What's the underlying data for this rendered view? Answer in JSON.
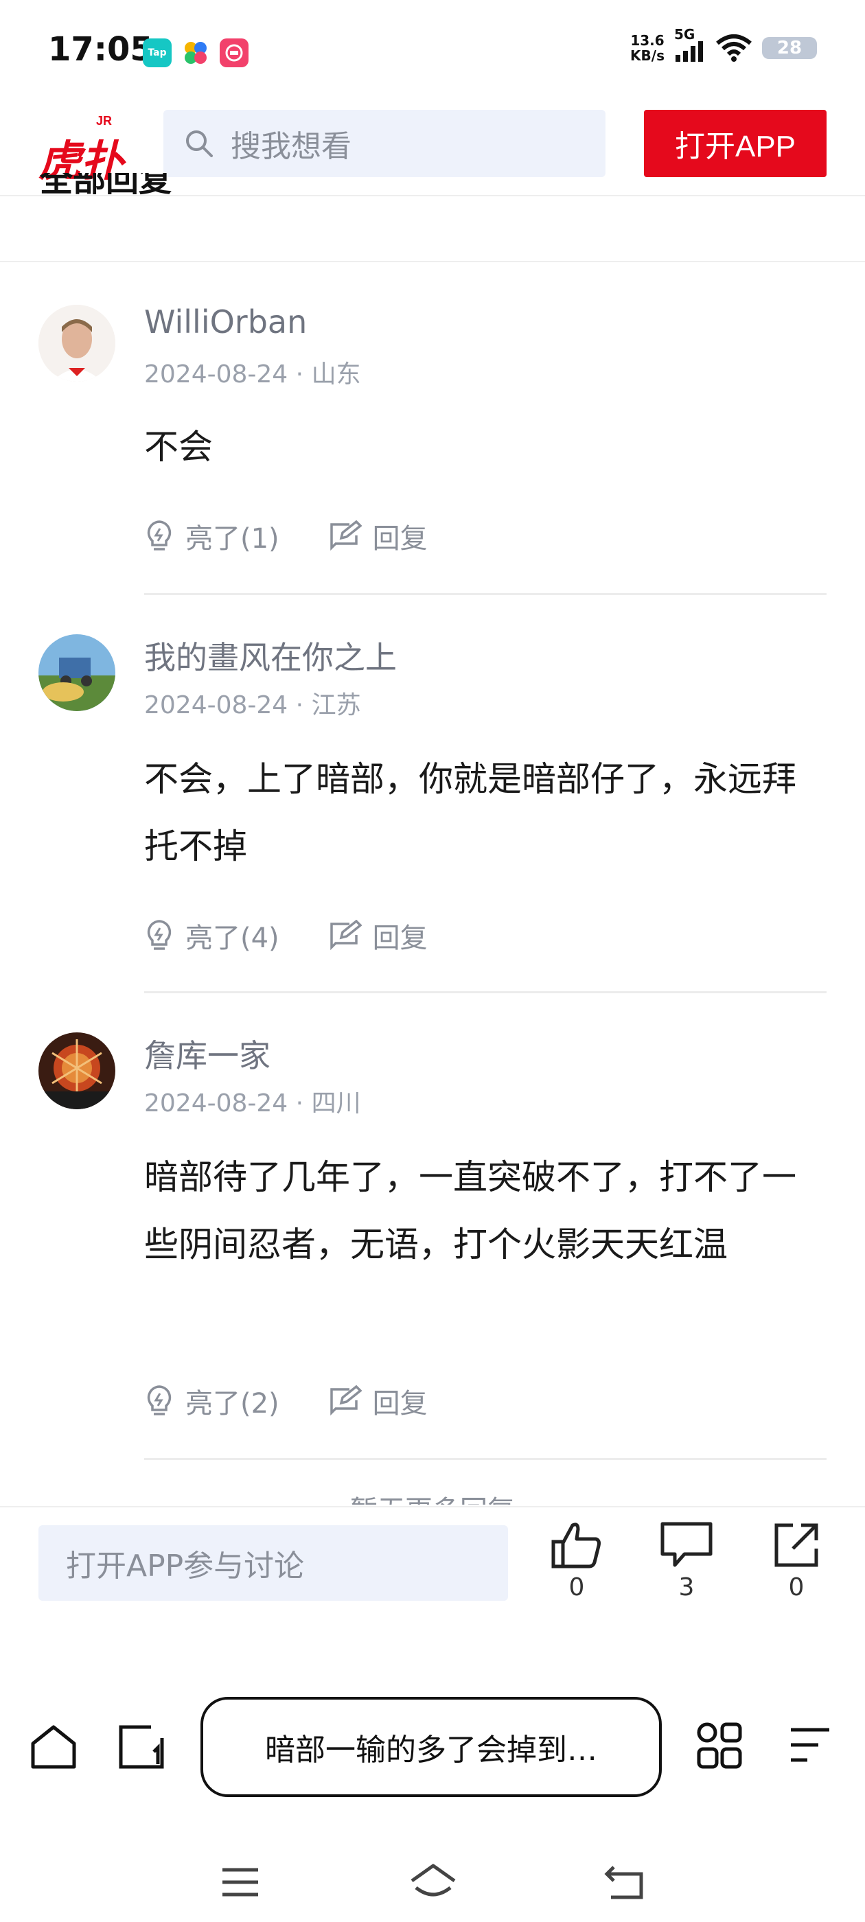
{
  "status_bar": {
    "time": "17:05",
    "net_speed_value": "13.6",
    "net_speed_unit": "KB/s",
    "network": "5G",
    "battery": "28",
    "app_icons": [
      {
        "name": "taptap-icon",
        "label": "Tap",
        "color": "#16c7c4"
      },
      {
        "name": "colorful-app-icon",
        "label": "",
        "color": "#2f7bf5"
      },
      {
        "name": "pink-app-icon",
        "label": "",
        "color": "#f2416b"
      }
    ]
  },
  "header": {
    "logo_text": "虎扑",
    "logo_badge": "JR",
    "search_placeholder": "搜我想看",
    "open_app_label": "打开APP"
  },
  "section": {
    "heading": "全部回复"
  },
  "comments": [
    {
      "username": "WilliOrban",
      "date": "2024-08-24",
      "location": "山东",
      "text": "不会",
      "likes_label": "亮了(1)",
      "reply_label": "回复"
    },
    {
      "username": "我的畫风在你之上",
      "date": "2024-08-24",
      "location": "江苏",
      "text": "不会，上了暗部，你就是暗部仔了，永远拜托不掉",
      "likes_label": "亮了(4)",
      "reply_label": "回复"
    },
    {
      "username": "詹库一家",
      "date": "2024-08-24",
      "location": "四川",
      "text": "暗部待了几年了，一直突破不了，打不了一些阴间忍者，无语，打个火影天天红温",
      "likes_label": "亮了(2)",
      "reply_label": "回复"
    }
  ],
  "more_replies": "暂无更多回复",
  "bottom_bar": {
    "discuss_placeholder": "打开APP参与讨论",
    "like_count": "0",
    "comment_count": "3",
    "share_count": "0"
  },
  "browser": {
    "url_title": "暗部一输的多了会掉到…"
  }
}
